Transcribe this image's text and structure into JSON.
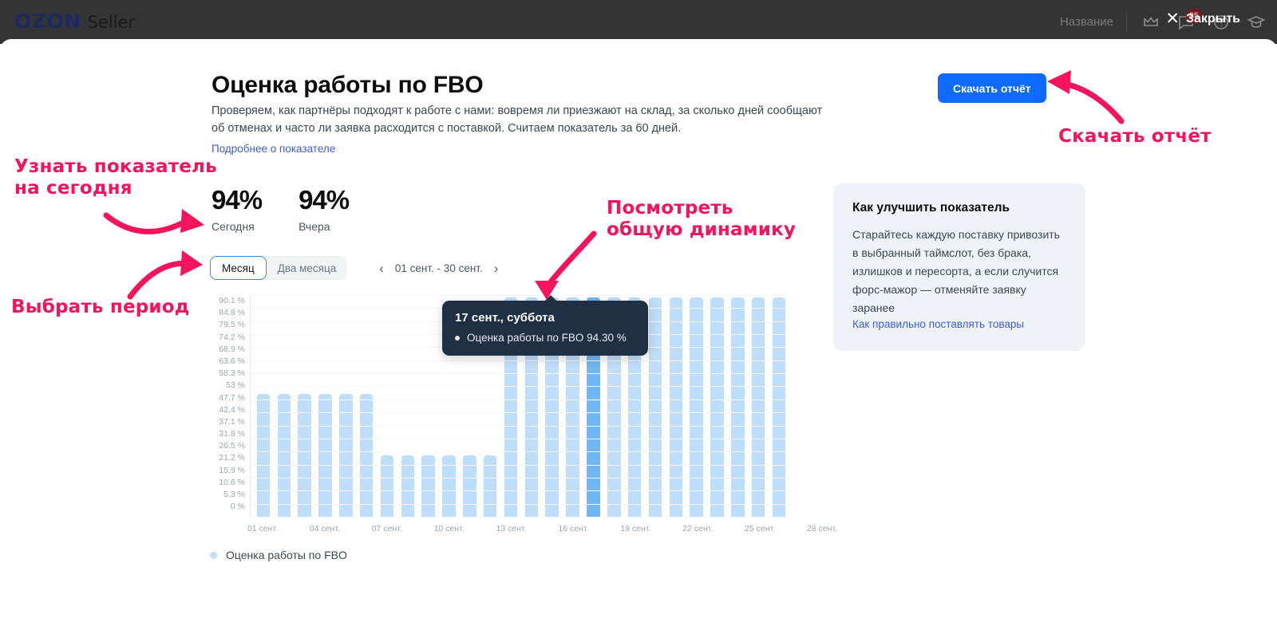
{
  "topbar": {
    "brand_ozon": "OZON",
    "brand_seller": "Seller",
    "account_name": "Название",
    "notifications_badge": "85",
    "close_label": "Закрыть",
    "close_x": "✕"
  },
  "header": {
    "title": "Оценка работы по FBO",
    "description": "Проверяем, как партнёры подходят к работе с нами: вовремя ли приезжают на склад, за сколько дней сообщают об отменах и часто ли заявка расходится с поставкой. Считаем показатель за 60 дней.",
    "more_link": "Подробнее о показателе",
    "download_button": "Скачать отчёт"
  },
  "metrics": [
    {
      "value": "94%",
      "label": "Сегодня"
    },
    {
      "value": "94%",
      "label": "Вчера"
    }
  ],
  "controls": {
    "period_options": [
      "Месяц",
      "Два месяца"
    ],
    "selected_period": "Месяц",
    "range_label": "01 сент. - 30 сент.",
    "prev_arrow": "‹",
    "next_arrow": "›"
  },
  "tooltip": {
    "title": "17 сент., суббота",
    "metric": "Оценка работы по FBO 94.30 %"
  },
  "legend": {
    "label": "Оценка работы по FBO",
    "color": "#bfdefb"
  },
  "card": {
    "title": "Как улучшить показатель",
    "body": "Старайтесь каждую поставку привозить в выбранный таймслот, без брака, излишков и пересорта, а если случится форс-мажор — отменяйте заявку заранее",
    "link": "Как правильно поставлять товары"
  },
  "annotations": [
    {
      "id": "anno-today",
      "text": "Узнать показатель\nна сегодня"
    },
    {
      "id": "anno-period",
      "text": "Выбрать период"
    },
    {
      "id": "anno-dynamics",
      "text": "Посмотреть\nобщую динамику"
    },
    {
      "id": "anno-download",
      "text": "Скачать отчёт"
    }
  ],
  "colors": {
    "accent_blue": "#0f6bff",
    "bar": "#bfdefb",
    "bar_highlight": "#6fb8f4",
    "annotation_pink": "#f4145b",
    "tooltip_bg": "#1f3044",
    "card_bg": "#eff3f8"
  },
  "chart_data": {
    "type": "bar",
    "title": "Оценка работы по FBO",
    "xlabel": "",
    "ylabel": "%",
    "ylim": [
      0,
      95.4
    ],
    "grid": true,
    "legend_position": "bottom-left",
    "y_ticks": [
      "90.1 %",
      "84.8 %",
      "79.5 %",
      "74.2 %",
      "68.9 %",
      "63.6 %",
      "58.3 %",
      "53 %",
      "47.7 %",
      "42.4 %",
      "37.1 %",
      "31.8 %",
      "26.5 %",
      "21.2 %",
      "15.9 %",
      "10.6 %",
      "5.3 %",
      "0 %"
    ],
    "x_tick_labels": [
      "01 сент.",
      "04 сент.",
      "07 сент.",
      "10 сент.",
      "13 сент.",
      "16 сент.",
      "19 сент.",
      "22 сент.",
      "25 сент.",
      "28 сент."
    ],
    "categories": [
      "01 сент.",
      "02 сент.",
      "03 сент.",
      "04 сент.",
      "05 сент.",
      "06 сент.",
      "07 сент.",
      "08 сент.",
      "09 сент.",
      "10 сент.",
      "11 сент.",
      "12 сент.",
      "13 сент.",
      "14 сент.",
      "15 сент.",
      "16 сент.",
      "17 сент.",
      "18 сент.",
      "19 сент.",
      "20 сент.",
      "21 сент.",
      "22 сент.",
      "23 сент.",
      "24 сент.",
      "25 сент.",
      "26 сент."
    ],
    "values": [
      53,
      53,
      53,
      53,
      53,
      53,
      26.5,
      26.5,
      26.5,
      26.5,
      26.5,
      26.5,
      94.3,
      94.3,
      94.3,
      94.3,
      94.3,
      94.3,
      94.3,
      94.3,
      94.3,
      94.3,
      94.3,
      94.3,
      94.3,
      94.3
    ],
    "highlight_index": 16,
    "highlight_value": 94.3,
    "series": [
      {
        "name": "Оценка работы по FBO",
        "color": "#bfdefb"
      }
    ]
  }
}
